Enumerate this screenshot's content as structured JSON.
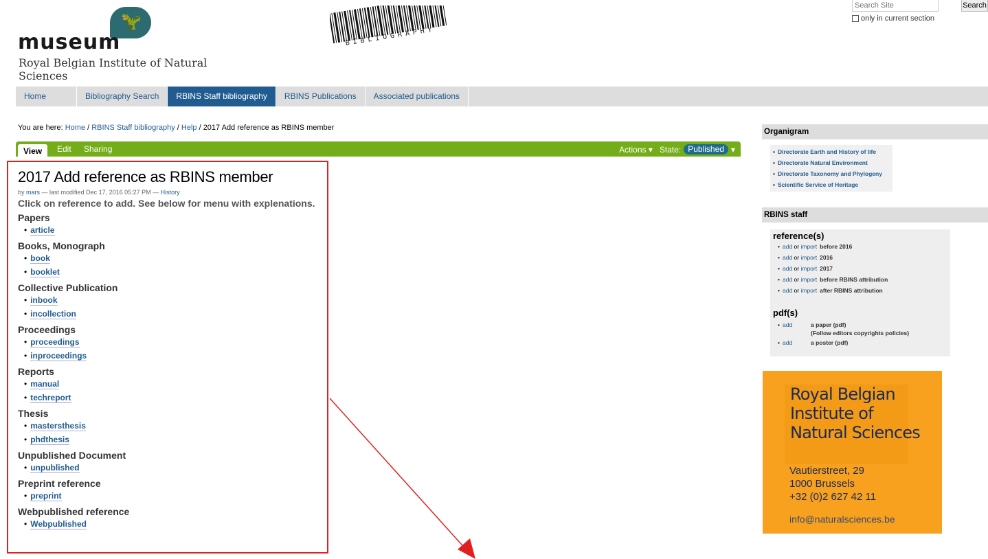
{
  "header": {
    "logo_word": "museum",
    "logo_subtitle": "Royal Belgian Institute of Natural Sciences",
    "barcode_text": "BIBLIOGRAPHY",
    "search_placeholder": "Search Site",
    "search_button": "Search",
    "search_option": "only in current section"
  },
  "nav": {
    "tabs": [
      {
        "label": "Home",
        "active": false
      },
      {
        "label": "Bibliography Search",
        "active": false
      },
      {
        "label": "RBINS Staff bibliography",
        "active": true
      },
      {
        "label": "RBINS Publications",
        "active": false
      },
      {
        "label": "Associated publications",
        "active": false
      }
    ]
  },
  "breadcrumb": {
    "prefix": "You are here:",
    "items": [
      "Home",
      "RBINS Staff bibliography",
      "Help"
    ],
    "current": "2017 Add reference as RBINS member"
  },
  "editbar": {
    "view": "View",
    "edit": "Edit",
    "sharing": "Sharing",
    "actions": "Actions ▾",
    "state_label": "State:",
    "state_value": "Published",
    "state_arrow": "▾"
  },
  "main": {
    "title": "2017 Add reference as RBINS member",
    "byline_prefix": "by",
    "author": "mars",
    "byline_mid": "— last modified Dec 17, 2016 05:27 PM —",
    "history": "History",
    "intro": "Click on reference to add. See below for menu with explenations.",
    "sections": [
      {
        "heading": "Papers",
        "items": [
          "article"
        ]
      },
      {
        "heading": "Books, Monograph",
        "items": [
          "book",
          "booklet"
        ]
      },
      {
        "heading": "Collective Publication",
        "items": [
          "inbook",
          "incollection"
        ]
      },
      {
        "heading": "Proceedings",
        "items": [
          "proceedings",
          "inproceedings"
        ]
      },
      {
        "heading": "Reports",
        "items": [
          "manual",
          "techreport"
        ]
      },
      {
        "heading": "Thesis",
        "items": [
          "mastersthesis",
          "phdthesis"
        ]
      },
      {
        "heading": "Unpublished Document",
        "items": [
          "unpublished"
        ]
      },
      {
        "heading": "Preprint reference",
        "items": [
          "preprint"
        ]
      },
      {
        "heading": "Webpublished reference",
        "items": [
          "Webpublished"
        ]
      }
    ]
  },
  "sidebar": {
    "organigram": {
      "title": "Organigram",
      "items": [
        "Directorate Earth and History of life",
        "Directorate Natural Environment",
        "Directorate Taxonomy and Phylogeny",
        "Scientific Service of Heritage"
      ]
    },
    "staff": {
      "title": "RBINS staff",
      "references_heading": "reference(s)",
      "add": "add",
      "or": "or",
      "import": "import",
      "references": [
        "before 2016",
        "2016",
        "2017",
        "before RBINS attribution",
        "after RBINS attribution"
      ],
      "pdfs_heading": "pdf(s)",
      "pdf1_desc": "a paper (pdf)",
      "pdf1_note": "(Follow editors copyrights policies)",
      "pdf2_desc": "a poster (pdf)"
    },
    "banner": {
      "name_line1": "Royal Belgian",
      "name_line2": "Institute of",
      "name_line3": "Natural Sciences",
      "street": "Vautierstreet, 29",
      "city": "1000 Brussels",
      "phone": "+32 (0)2 627 42 11",
      "email": "info@naturalsciences.be"
    }
  },
  "colors": {
    "nav_active": "#205c90",
    "editbar": "#74ad1a",
    "annotation": "#e02020",
    "banner": "#f7a11f"
  }
}
